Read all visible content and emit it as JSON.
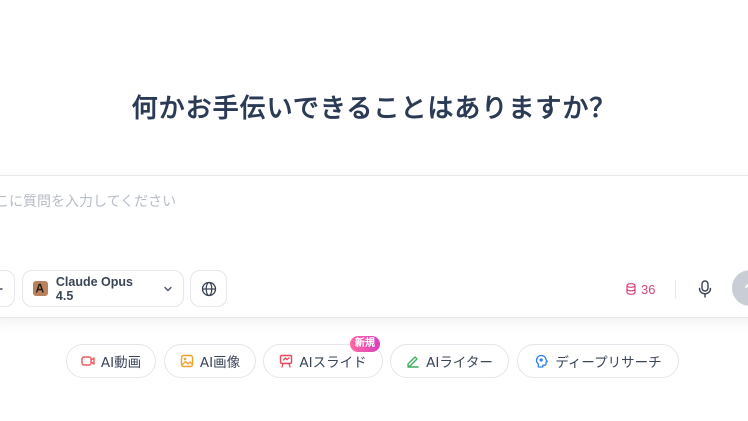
{
  "headline": "何かお手伝いできることはありますか？",
  "composer": {
    "placeholder": "ここに質問を入力してください",
    "model_name": "Claude Opus 4.5",
    "credits": "36"
  },
  "chips": [
    {
      "label": "AI動画",
      "icon": "video-icon",
      "color": "#ef5a5a"
    },
    {
      "label": "AI画像",
      "icon": "image-icon",
      "color": "#f0a22a"
    },
    {
      "label": "AIスライド",
      "icon": "presentation-icon",
      "color": "#e8475a",
      "badge": "新規"
    },
    {
      "label": "AIライター",
      "icon": "pen-icon",
      "color": "#3fae5a"
    },
    {
      "label": "ディープリサーチ",
      "icon": "research-icon",
      "color": "#2f80ed"
    }
  ],
  "colors": {
    "headline": "#2b3a55",
    "credits": "#d3457a",
    "send_disabled": "#c9ced6"
  }
}
